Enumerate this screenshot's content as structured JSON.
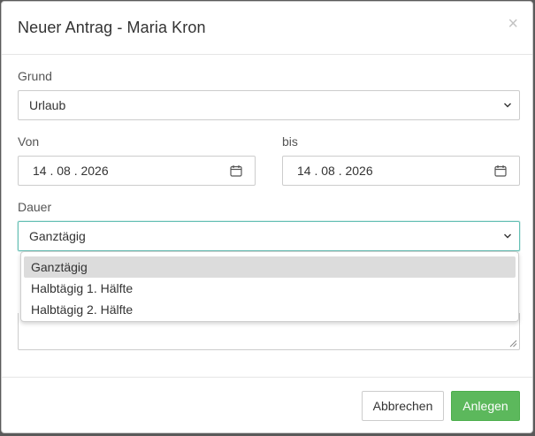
{
  "modal": {
    "title": "Neuer Antrag - Maria Kron",
    "close_symbol": "×"
  },
  "form": {
    "grund": {
      "label": "Grund",
      "value": "Urlaub"
    },
    "von": {
      "label": "Von",
      "value": "14 . 08 . 2026"
    },
    "bis": {
      "label": "bis",
      "value": "14 . 08 . 2026"
    },
    "dauer": {
      "label": "Dauer",
      "value": "Ganztägig",
      "options": [
        "Ganztägig",
        "Halbtägig 1. Hälfte",
        "Halbtägig 2. Hälfte"
      ],
      "selected_index": 0
    }
  },
  "footer": {
    "cancel_label": "Abbrechen",
    "submit_label": "Anlegen"
  },
  "colors": {
    "submit": "#5cb85c",
    "focus_border": "#66c0b5",
    "option_highlight": "#dcdcdc"
  },
  "icons": [
    "close-icon",
    "chevron-down-icon",
    "calendar-icon",
    "resize-handle-icon"
  ]
}
